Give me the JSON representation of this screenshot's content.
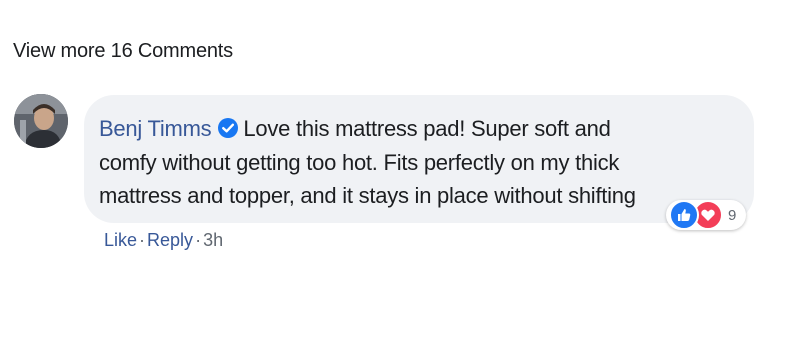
{
  "comments_section": {
    "view_more_label": "View more 16 Comments"
  },
  "comment": {
    "author": "Benj Timms",
    "verified": true,
    "text": "Love this mattress pad! Super soft and comfy without getting too hot. Fits perfectly on my thick mattress and topper, and it stays in place without shifting",
    "line1": "Love this mattress pad! Super soft and",
    "line2": "comfy without getting too hot. Fits perfectly on my thick",
    "line3": "mattress and topper, and it stays in place without shifting",
    "reactions": {
      "types": [
        "like-icon",
        "love-icon"
      ],
      "count": "9"
    },
    "actions": {
      "like_label": "Like",
      "reply_label": "Reply",
      "separator": "·",
      "timestamp": "3h"
    }
  },
  "colors": {
    "link_blue": "#385898",
    "bubble_bg": "#f0f2f5",
    "like_blue": "#2078f4",
    "love_red": "#f33e58",
    "verified_blue": "#1877f2"
  }
}
